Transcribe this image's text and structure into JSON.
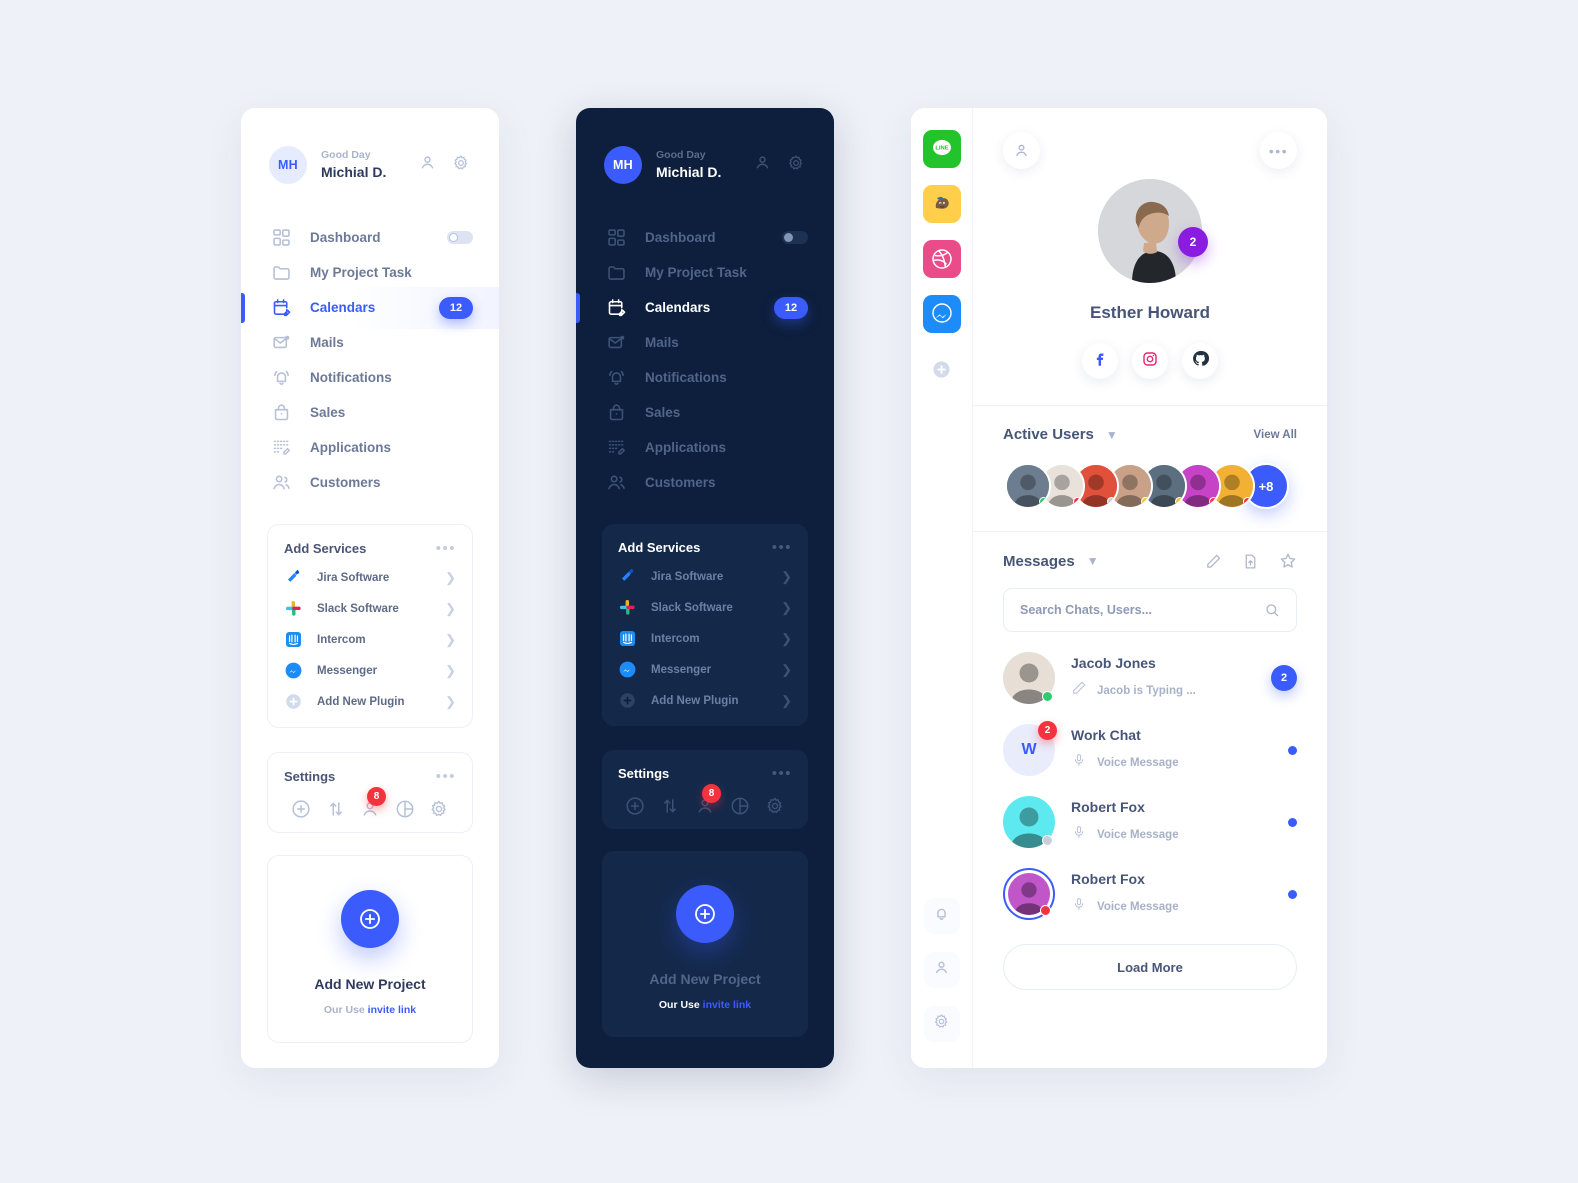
{
  "menu": {
    "avatar_initials": "MH",
    "greeting": "Good Day",
    "username": "Michial D.",
    "nav": [
      {
        "label": "Dashboard",
        "icon": "dashboard-icon",
        "right": "toggle"
      },
      {
        "label": "My Project Task",
        "icon": "folder-icon",
        "right": "none"
      },
      {
        "label": "Calendars",
        "icon": "calendar-edit-icon",
        "right": "badge",
        "badge": "12",
        "active": true
      },
      {
        "label": "Mails",
        "icon": "mail-icon",
        "right": "none"
      },
      {
        "label": "Notifications",
        "icon": "bell-icon",
        "right": "none"
      },
      {
        "label": "Sales",
        "icon": "bag-icon",
        "right": "none"
      },
      {
        "label": "Applications",
        "icon": "apps-edit-icon",
        "right": "none"
      },
      {
        "label": "Customers",
        "icon": "users-icon",
        "right": "none"
      }
    ],
    "services_title": "Add Services",
    "services": [
      {
        "label": "Jira Software",
        "icon": "jira-icon"
      },
      {
        "label": "Slack Software",
        "icon": "slack-icon"
      },
      {
        "label": "Intercom",
        "icon": "intercom-icon"
      },
      {
        "label": "Messenger",
        "icon": "messenger-icon"
      },
      {
        "label": "Add New Plugin",
        "icon": "plus-circle-icon"
      }
    ],
    "settings_title": "Settings",
    "settings_badge": "8",
    "settings_icons": [
      "plus-circle-icon",
      "sort-arrows-icon",
      "person-icon",
      "pie-chart-icon",
      "gear-icon"
    ],
    "project_title": "Add New Project",
    "project_sub": "Our Use",
    "project_link": "invite link",
    "dots": "•••"
  },
  "chat": {
    "rail_apps": [
      {
        "name": "line-icon",
        "color": "#22c32b",
        "label": "LINE"
      },
      {
        "name": "mailchimp-icon",
        "color": "#ffcf4b",
        "label": ""
      },
      {
        "name": "dribbble-icon",
        "color": "#ea4c89",
        "label": ""
      },
      {
        "name": "messenger-icon",
        "color": "#1d8cf8",
        "label": ""
      }
    ],
    "rail_add": "plus-circle-icon",
    "rail_bottom": [
      "bell-icon",
      "person-icon",
      "gear-icon"
    ],
    "profile": {
      "name": "Esther Howard",
      "badge": "2",
      "socials": [
        "facebook-icon",
        "instagram-icon",
        "github-icon"
      ]
    },
    "active_users": {
      "title": "Active Users",
      "view_all": "View All",
      "more_count": "+8",
      "avatars": [
        {
          "bg": "#6c7d8f",
          "dot": "#2ecc71"
        },
        {
          "bg": "#e9e2db",
          "dot": "#f5333f"
        },
        {
          "bg": "#e0503a",
          "dot": "#c9cedb"
        },
        {
          "bg": "#c8a188",
          "dot": "#f5c33b"
        },
        {
          "bg": "#5b6f80",
          "dot": "#f5c33b"
        },
        {
          "bg": "#c642c6",
          "dot": "#f5333f"
        },
        {
          "bg": "#f2b134",
          "dot": "#f5333f"
        }
      ]
    },
    "messages": {
      "title": "Messages",
      "actions": [
        "pencil-icon",
        "file-upload-icon",
        "star-icon"
      ],
      "search_placeholder": "Search Chats, Users...",
      "search_value": "",
      "items": [
        {
          "name": "Jacob Jones",
          "sub": "Jacob is Typing ...",
          "sub_icon": "pencil-icon",
          "avatar_type": "photo",
          "bg": "#e7ded6",
          "status": "#2ecc71",
          "right": "badge",
          "badge": "2",
          "ring": false,
          "red_badge": ""
        },
        {
          "name": "Work Chat",
          "sub": "Voice Message",
          "sub_icon": "mic-icon",
          "avatar_type": "initial",
          "initial": "W",
          "bg": "#e8ecfb",
          "status": "",
          "right": "dot",
          "badge": "",
          "ring": false,
          "red_badge": "2"
        },
        {
          "name": "Robert Fox",
          "sub": "Voice Message",
          "sub_icon": "mic-icon",
          "avatar_type": "photo",
          "bg": "#5ce9ef",
          "status": "#c9cedb",
          "right": "dot",
          "badge": "",
          "ring": false,
          "red_badge": ""
        },
        {
          "name": "Robert Fox",
          "sub": "Voice Message",
          "sub_icon": "mic-icon",
          "avatar_type": "photo",
          "bg": "#c156c9",
          "status": "#f5333f",
          "right": "dot",
          "badge": "",
          "ring": true,
          "red_badge": ""
        }
      ],
      "load_more": "Load More"
    }
  },
  "colors": {
    "accent": "#3b5bfd",
    "dark_bg": "#0d1f3c",
    "dark_card": "#14294a",
    "page_bg": "#eef1f7",
    "red": "#f5333f",
    "purple": "#8a1ce0"
  }
}
